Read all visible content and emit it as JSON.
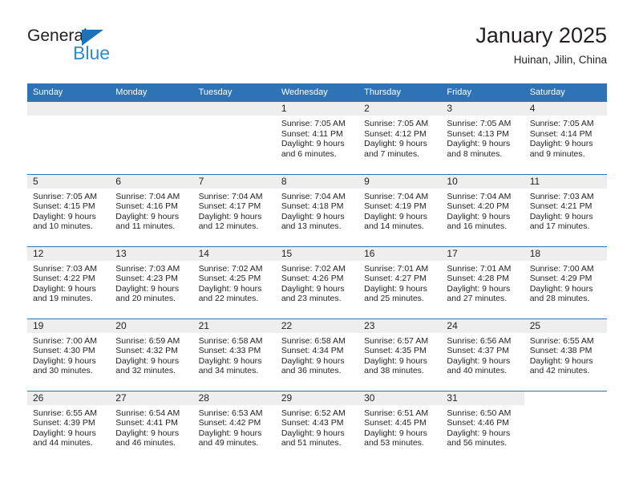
{
  "logo": {
    "word1": "General",
    "word2": "Blue",
    "triangle_color": "#1e72b8",
    "blue_color": "#2e8bd0"
  },
  "header": {
    "title": "January 2025",
    "subtitle": "Huinan, Jilin, China"
  },
  "theme": {
    "header_blue": "#2e73b5",
    "daynum_grey": "#eeeeee",
    "text": "#231f20"
  },
  "calendar": {
    "weekday_headers": [
      "Sunday",
      "Monday",
      "Tuesday",
      "Wednesday",
      "Thursday",
      "Friday",
      "Saturday"
    ],
    "weeks": [
      [
        {
          "day": "",
          "lines": []
        },
        {
          "day": "",
          "lines": []
        },
        {
          "day": "",
          "lines": []
        },
        {
          "day": "1",
          "lines": [
            "Sunrise: 7:05 AM",
            "Sunset: 4:11 PM",
            "Daylight: 9 hours",
            "and 6 minutes."
          ]
        },
        {
          "day": "2",
          "lines": [
            "Sunrise: 7:05 AM",
            "Sunset: 4:12 PM",
            "Daylight: 9 hours",
            "and 7 minutes."
          ]
        },
        {
          "day": "3",
          "lines": [
            "Sunrise: 7:05 AM",
            "Sunset: 4:13 PM",
            "Daylight: 9 hours",
            "and 8 minutes."
          ]
        },
        {
          "day": "4",
          "lines": [
            "Sunrise: 7:05 AM",
            "Sunset: 4:14 PM",
            "Daylight: 9 hours",
            "and 9 minutes."
          ]
        }
      ],
      [
        {
          "day": "5",
          "lines": [
            "Sunrise: 7:05 AM",
            "Sunset: 4:15 PM",
            "Daylight: 9 hours",
            "and 10 minutes."
          ]
        },
        {
          "day": "6",
          "lines": [
            "Sunrise: 7:04 AM",
            "Sunset: 4:16 PM",
            "Daylight: 9 hours",
            "and 11 minutes."
          ]
        },
        {
          "day": "7",
          "lines": [
            "Sunrise: 7:04 AM",
            "Sunset: 4:17 PM",
            "Daylight: 9 hours",
            "and 12 minutes."
          ]
        },
        {
          "day": "8",
          "lines": [
            "Sunrise: 7:04 AM",
            "Sunset: 4:18 PM",
            "Daylight: 9 hours",
            "and 13 minutes."
          ]
        },
        {
          "day": "9",
          "lines": [
            "Sunrise: 7:04 AM",
            "Sunset: 4:19 PM",
            "Daylight: 9 hours",
            "and 14 minutes."
          ]
        },
        {
          "day": "10",
          "lines": [
            "Sunrise: 7:04 AM",
            "Sunset: 4:20 PM",
            "Daylight: 9 hours",
            "and 16 minutes."
          ]
        },
        {
          "day": "11",
          "lines": [
            "Sunrise: 7:03 AM",
            "Sunset: 4:21 PM",
            "Daylight: 9 hours",
            "and 17 minutes."
          ]
        }
      ],
      [
        {
          "day": "12",
          "lines": [
            "Sunrise: 7:03 AM",
            "Sunset: 4:22 PM",
            "Daylight: 9 hours",
            "and 19 minutes."
          ]
        },
        {
          "day": "13",
          "lines": [
            "Sunrise: 7:03 AM",
            "Sunset: 4:23 PM",
            "Daylight: 9 hours",
            "and 20 minutes."
          ]
        },
        {
          "day": "14",
          "lines": [
            "Sunrise: 7:02 AM",
            "Sunset: 4:25 PM",
            "Daylight: 9 hours",
            "and 22 minutes."
          ]
        },
        {
          "day": "15",
          "lines": [
            "Sunrise: 7:02 AM",
            "Sunset: 4:26 PM",
            "Daylight: 9 hours",
            "and 23 minutes."
          ]
        },
        {
          "day": "16",
          "lines": [
            "Sunrise: 7:01 AM",
            "Sunset: 4:27 PM",
            "Daylight: 9 hours",
            "and 25 minutes."
          ]
        },
        {
          "day": "17",
          "lines": [
            "Sunrise: 7:01 AM",
            "Sunset: 4:28 PM",
            "Daylight: 9 hours",
            "and 27 minutes."
          ]
        },
        {
          "day": "18",
          "lines": [
            "Sunrise: 7:00 AM",
            "Sunset: 4:29 PM",
            "Daylight: 9 hours",
            "and 28 minutes."
          ]
        }
      ],
      [
        {
          "day": "19",
          "lines": [
            "Sunrise: 7:00 AM",
            "Sunset: 4:30 PM",
            "Daylight: 9 hours",
            "and 30 minutes."
          ]
        },
        {
          "day": "20",
          "lines": [
            "Sunrise: 6:59 AM",
            "Sunset: 4:32 PM",
            "Daylight: 9 hours",
            "and 32 minutes."
          ]
        },
        {
          "day": "21",
          "lines": [
            "Sunrise: 6:58 AM",
            "Sunset: 4:33 PM",
            "Daylight: 9 hours",
            "and 34 minutes."
          ]
        },
        {
          "day": "22",
          "lines": [
            "Sunrise: 6:58 AM",
            "Sunset: 4:34 PM",
            "Daylight: 9 hours",
            "and 36 minutes."
          ]
        },
        {
          "day": "23",
          "lines": [
            "Sunrise: 6:57 AM",
            "Sunset: 4:35 PM",
            "Daylight: 9 hours",
            "and 38 minutes."
          ]
        },
        {
          "day": "24",
          "lines": [
            "Sunrise: 6:56 AM",
            "Sunset: 4:37 PM",
            "Daylight: 9 hours",
            "and 40 minutes."
          ]
        },
        {
          "day": "25",
          "lines": [
            "Sunrise: 6:55 AM",
            "Sunset: 4:38 PM",
            "Daylight: 9 hours",
            "and 42 minutes."
          ]
        }
      ],
      [
        {
          "day": "26",
          "lines": [
            "Sunrise: 6:55 AM",
            "Sunset: 4:39 PM",
            "Daylight: 9 hours",
            "and 44 minutes."
          ]
        },
        {
          "day": "27",
          "lines": [
            "Sunrise: 6:54 AM",
            "Sunset: 4:41 PM",
            "Daylight: 9 hours",
            "and 46 minutes."
          ]
        },
        {
          "day": "28",
          "lines": [
            "Sunrise: 6:53 AM",
            "Sunset: 4:42 PM",
            "Daylight: 9 hours",
            "and 49 minutes."
          ]
        },
        {
          "day": "29",
          "lines": [
            "Sunrise: 6:52 AM",
            "Sunset: 4:43 PM",
            "Daylight: 9 hours",
            "and 51 minutes."
          ]
        },
        {
          "day": "30",
          "lines": [
            "Sunrise: 6:51 AM",
            "Sunset: 4:45 PM",
            "Daylight: 9 hours",
            "and 53 minutes."
          ]
        },
        {
          "day": "31",
          "lines": [
            "Sunrise: 6:50 AM",
            "Sunset: 4:46 PM",
            "Daylight: 9 hours",
            "and 56 minutes."
          ]
        },
        {
          "day": "",
          "lines": []
        }
      ]
    ]
  }
}
